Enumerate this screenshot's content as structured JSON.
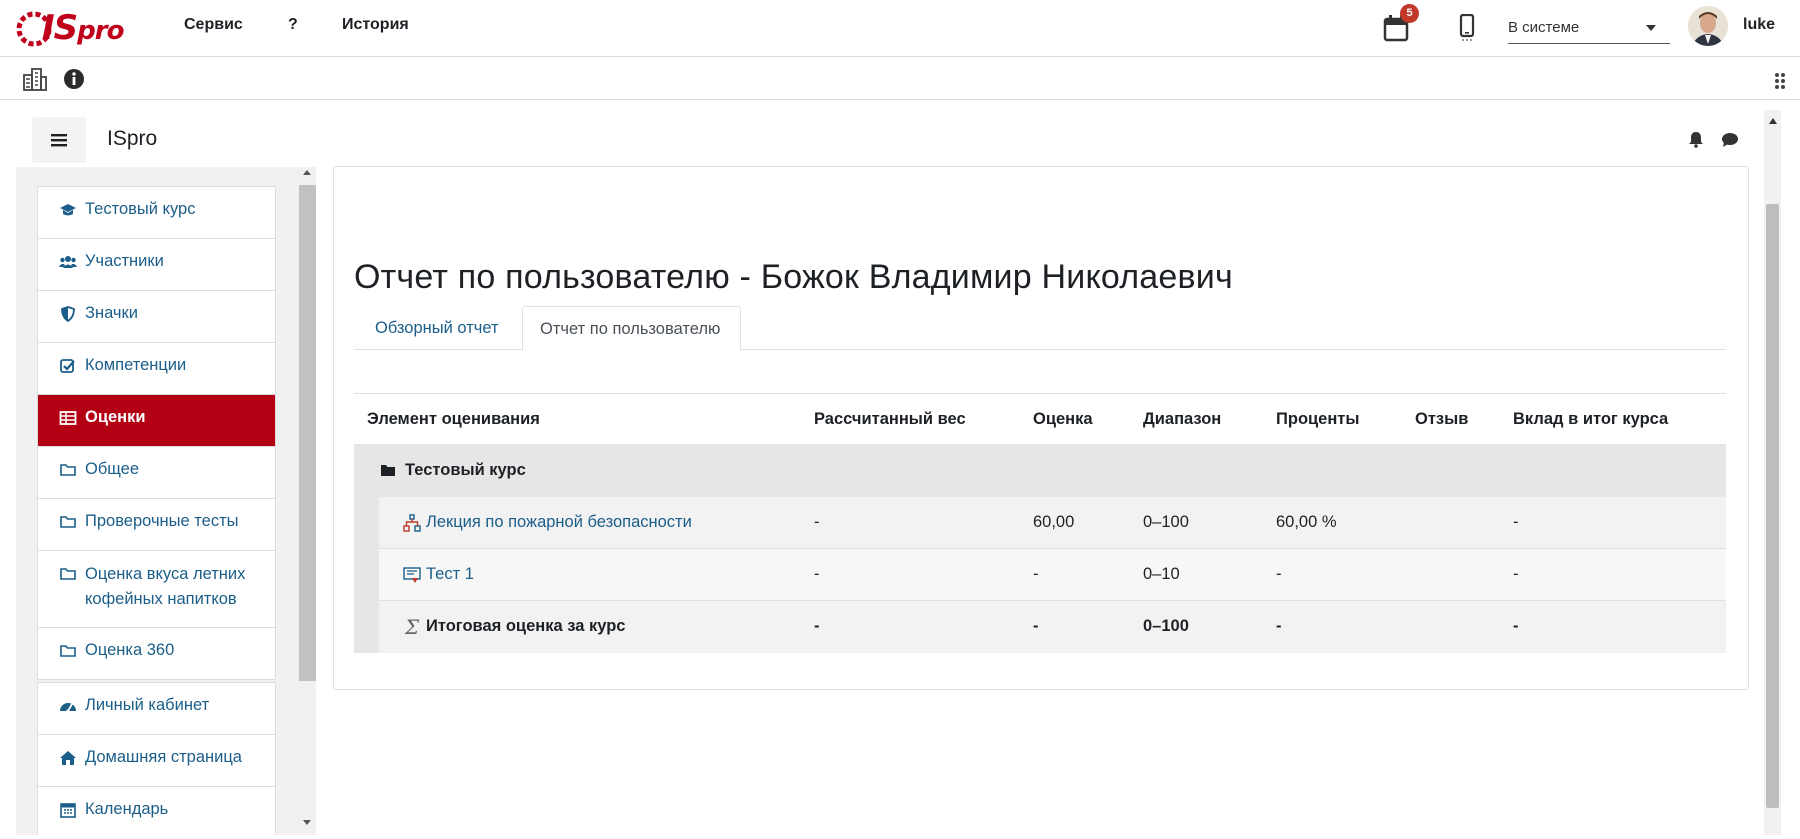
{
  "app": {
    "logo_text": "IS",
    "logo_text_pro": "pro"
  },
  "topmenu": {
    "service": "Сервис",
    "help": "?",
    "history": "История"
  },
  "notifications": {
    "calendar_count": "5"
  },
  "status": {
    "selected": "В системе"
  },
  "user": {
    "name": "luke"
  },
  "site": {
    "name": "ISpro"
  },
  "sidebar": {
    "course_items": [
      {
        "label": "Тестовый курс",
        "icon": "graduation-cap-icon"
      },
      {
        "label": "Участники",
        "icon": "users-icon"
      },
      {
        "label": "Значки",
        "icon": "shield-icon"
      },
      {
        "label": "Компетенции",
        "icon": "check-square-icon"
      },
      {
        "label": "Оценки",
        "icon": "table-icon",
        "active": true
      },
      {
        "label": "Общее",
        "icon": "folder-icon"
      },
      {
        "label": "Проверочные тесты",
        "icon": "folder-icon"
      },
      {
        "label": "Оценка вкуса летних кофейных напитков",
        "icon": "folder-icon"
      },
      {
        "label": "Оценка 360",
        "icon": "folder-icon"
      }
    ],
    "nav_items": [
      {
        "label": "Личный кабинет",
        "icon": "dashboard-icon"
      },
      {
        "label": "Домашняя страница",
        "icon": "home-icon"
      },
      {
        "label": "Календарь",
        "icon": "calendar-icon"
      }
    ]
  },
  "report": {
    "title": "Отчет по пользователю - Божок Владимир Николаевич",
    "tabs": [
      {
        "label": "Обзорный отчет",
        "active": false
      },
      {
        "label": "Отчет по пользователю",
        "active": true
      }
    ],
    "columns": [
      "Элемент оценивания",
      "Рассчитанный вес",
      "Оценка",
      "Диапазон",
      "Проценты",
      "Отзыв",
      "Вклад в итог курса"
    ],
    "category": "Тестовый курс",
    "rows": [
      {
        "name": "Лекция по пожарной безопасности",
        "weight": "-",
        "grade": "60,00",
        "range": "0–100",
        "percent": "60,00 %",
        "feedback": "",
        "contribution": "-",
        "icon": "lesson-icon"
      },
      {
        "name": "Тест 1",
        "weight": "-",
        "grade": "-",
        "range": "0–10",
        "percent": "-",
        "feedback": "",
        "contribution": "-",
        "icon": "quiz-icon"
      },
      {
        "name": "Итоговая оценка за курс",
        "weight": "-",
        "grade": "-",
        "range": "0–100",
        "percent": "-",
        "feedback": "",
        "contribution": "-",
        "icon": "sigma-icon"
      }
    ]
  },
  "colors": {
    "brand_red": "#b30012",
    "link": "#1b5e8a",
    "badge": "#c0392b"
  }
}
